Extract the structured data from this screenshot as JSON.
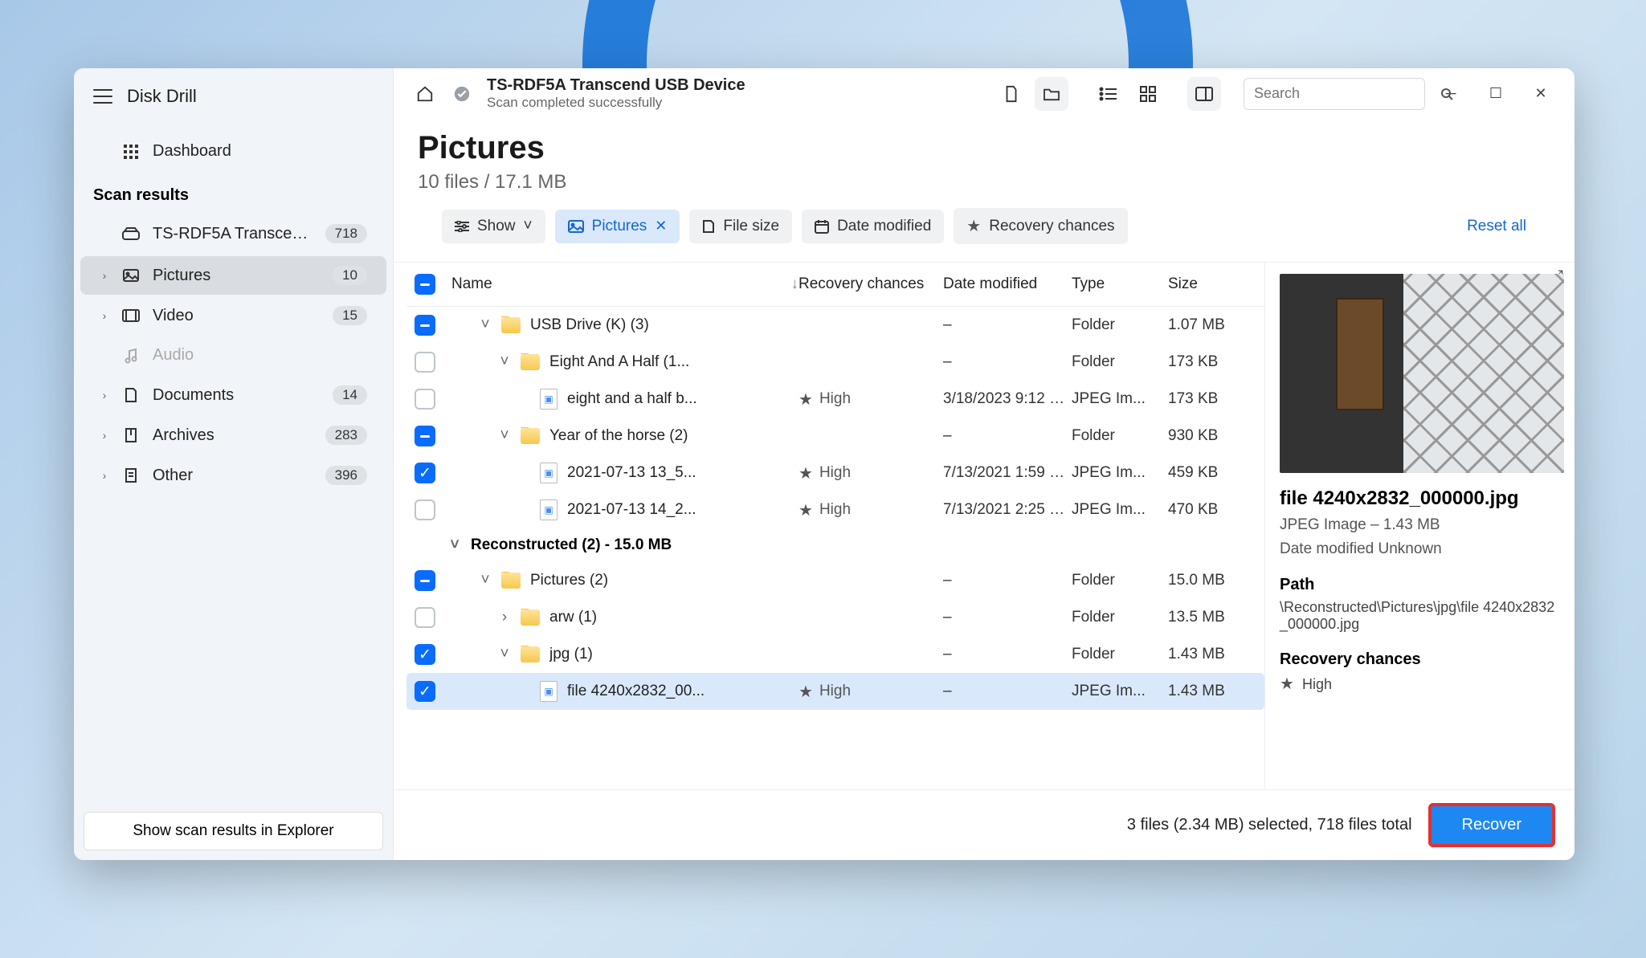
{
  "app": {
    "name": "Disk Drill"
  },
  "sidebar": {
    "dashboard": "Dashboard",
    "scan_results_title": "Scan results",
    "device": {
      "label": "TS-RDF5A Transcend US...",
      "badge": "718"
    },
    "categories": [
      {
        "label": "Pictures",
        "badge": "10",
        "active": true
      },
      {
        "label": "Video",
        "badge": "15"
      },
      {
        "label": "Audio",
        "badge": ""
      },
      {
        "label": "Documents",
        "badge": "14"
      },
      {
        "label": "Archives",
        "badge": "283"
      },
      {
        "label": "Other",
        "badge": "396"
      }
    ],
    "bottom_button": "Show scan results in Explorer"
  },
  "header": {
    "device_name": "TS-RDF5A Transcend USB Device",
    "status": "Scan completed successfully",
    "search_placeholder": "Search"
  },
  "page": {
    "title": "Pictures",
    "subtitle": "10 files / 17.1 MB"
  },
  "filters": {
    "show": "Show",
    "active": "Pictures",
    "file_size": "File size",
    "date_modified": "Date modified",
    "recovery": "Recovery chances",
    "reset": "Reset all"
  },
  "columns": {
    "name": "Name",
    "recovery": "Recovery chances",
    "date": "Date modified",
    "type": "Type",
    "size": "Size"
  },
  "rows": [
    {
      "cb": "indet",
      "indent": 1,
      "chev": "˅",
      "icon": "folder",
      "name": "USB Drive (K) (3)",
      "rec": "",
      "date": "–",
      "type": "Folder",
      "size": "1.07 MB"
    },
    {
      "cb": "",
      "indent": 2,
      "chev": "˅",
      "icon": "folder",
      "name": "Eight And A Half (1...",
      "rec": "",
      "date": "–",
      "type": "Folder",
      "size": "173 KB"
    },
    {
      "cb": "",
      "indent": 3,
      "chev": "",
      "icon": "file",
      "name": "eight and a half b...",
      "rec": "High",
      "date": "3/18/2023 9:12 PM",
      "type": "JPEG Im...",
      "size": "173 KB"
    },
    {
      "cb": "indet",
      "indent": 2,
      "chev": "˅",
      "icon": "folder",
      "name": "Year of the horse (2)",
      "rec": "",
      "date": "–",
      "type": "Folder",
      "size": "930 KB"
    },
    {
      "cb": "checked",
      "indent": 3,
      "chev": "",
      "icon": "file",
      "name": "2021-07-13 13_5...",
      "rec": "High",
      "date": "7/13/2021 1:59 PM",
      "type": "JPEG Im...",
      "size": "459 KB"
    },
    {
      "cb": "",
      "indent": 3,
      "chev": "",
      "icon": "file",
      "name": "2021-07-13 14_2...",
      "rec": "High",
      "date": "7/13/2021 2:25 PM",
      "type": "JPEG Im...",
      "size": "470 KB"
    },
    {
      "group": true,
      "cb": "none",
      "chev": "˅",
      "name": "Reconstructed (2) - 15.0 MB"
    },
    {
      "cb": "indet",
      "indent": 1,
      "chev": "˅",
      "icon": "folder",
      "name": "Pictures (2)",
      "rec": "",
      "date": "–",
      "type": "Folder",
      "size": "15.0 MB"
    },
    {
      "cb": "",
      "indent": 2,
      "chev": "›",
      "icon": "folder",
      "name": "arw (1)",
      "rec": "",
      "date": "–",
      "type": "Folder",
      "size": "13.5 MB"
    },
    {
      "cb": "checked",
      "indent": 2,
      "chev": "˅",
      "icon": "folder",
      "name": "jpg (1)",
      "rec": "",
      "date": "–",
      "type": "Folder",
      "size": "1.43 MB"
    },
    {
      "cb": "checked",
      "indent": 3,
      "chev": "",
      "icon": "file",
      "name": "file 4240x2832_00...",
      "rec": "High",
      "date": "–",
      "type": "JPEG Im...",
      "size": "1.43 MB",
      "selected": true
    }
  ],
  "preview": {
    "filename": "file 4240x2832_000000.jpg",
    "meta": "JPEG Image – 1.43 MB",
    "date_modified": "Date modified Unknown",
    "path_label": "Path",
    "path_value": "\\Reconstructed\\Pictures\\jpg\\file 4240x2832_000000.jpg",
    "recovery_label": "Recovery chances",
    "recovery_value": "High"
  },
  "statusbar": {
    "summary": "3 files (2.34 MB) selected, 718 files total",
    "recover": "Recover"
  }
}
